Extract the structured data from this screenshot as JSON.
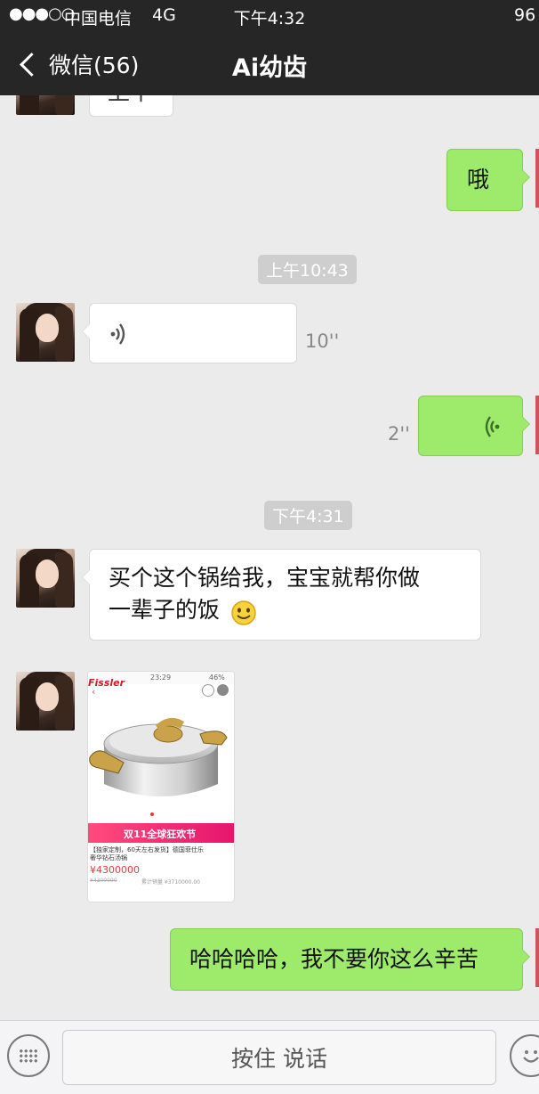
{
  "status_bar": {
    "signal": "●●●○○",
    "carrier": "中国电信",
    "network": "4G",
    "time": "下午4:32",
    "battery": "96"
  },
  "nav": {
    "back_label": "微信(56)",
    "title": "Ai幼齿"
  },
  "messages": {
    "partial_top_text": "上午",
    "msg1_text": "哦",
    "ts1": "上午10:43",
    "voice1_duration": "10''",
    "voice2_duration": "2''",
    "ts2": "下午4:31",
    "msg2_line1": "买个这个锅给我，宝宝就帮你做",
    "msg2_line2": "一辈子的饭",
    "msg3_text": "哈哈哈哈，我不要你这么辛苦"
  },
  "product_image": {
    "time": "23:29",
    "battery": "46%",
    "brand": "Fissler",
    "banner": "双11全球狂欢节",
    "desc": "【独家定制，60天左右发货】德国菲仕乐 奢华钻石汤锅",
    "price": "¥4300000",
    "orig_price": "¥4300000",
    "sales": "累计销量 ¥3710000.00"
  },
  "input_bar": {
    "hold_to_talk": "按住 说话"
  },
  "colors": {
    "bar_bg": "#262626",
    "chat_bg": "#ebebeb",
    "green_bubble": "#9eea6a",
    "white_bubble": "#ffffff"
  }
}
